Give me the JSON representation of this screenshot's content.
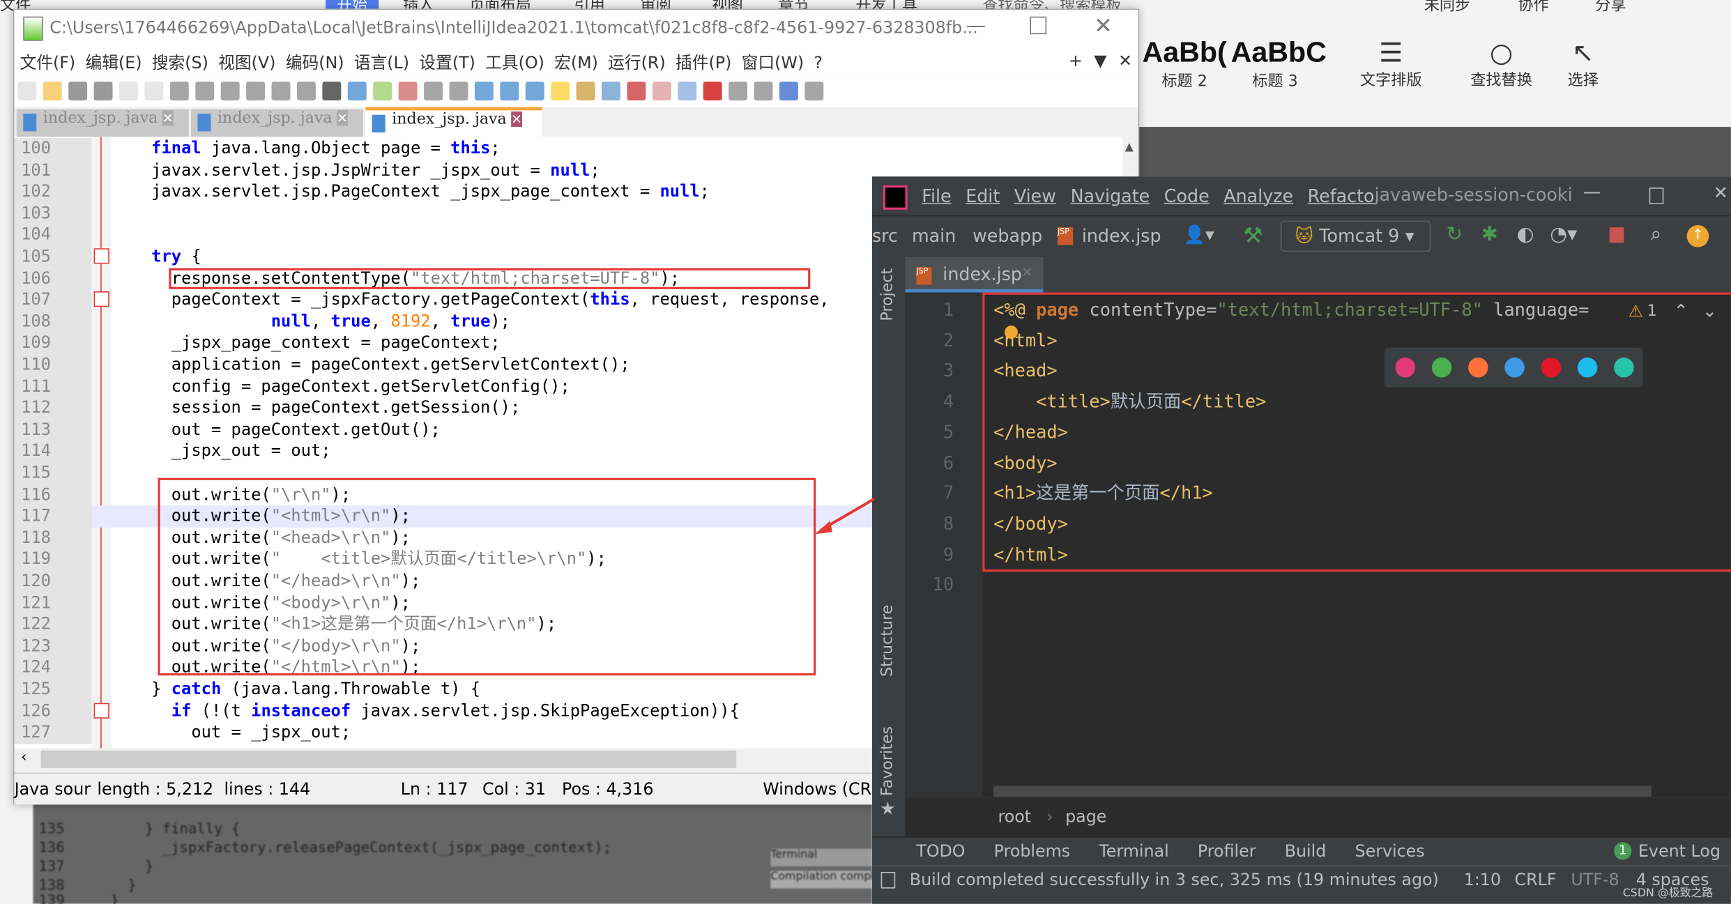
{
  "word_ribbon": {
    "tabs": [
      "文件",
      "开始",
      "插入",
      "页面布局",
      "引用",
      "审阅",
      "视图",
      "章节",
      "开发工具"
    ],
    "search": "查找命令、搜索模板",
    "right_actions": [
      "未同步",
      "协作",
      "分享"
    ],
    "styles": [
      {
        "sample": "AaBb(",
        "label": "标题 2"
      },
      {
        "sample": "AaBbC",
        "label": "标题 3"
      }
    ],
    "buttons": [
      "文字排版",
      "查找替换",
      "选择"
    ]
  },
  "npp": {
    "title": "C:\\Users\\1764466269\\AppData\\Local\\JetBrains\\IntelliJIdea2021.1\\tomcat\\f021c8f8-c8f2-4561-9927-6328308fb...",
    "menu": [
      "文件(F)",
      "编辑(E)",
      "搜索(S)",
      "视图(V)",
      "编码(N)",
      "语言(L)",
      "设置(T)",
      "工具(O)",
      "宏(M)",
      "运行(R)",
      "插件(P)",
      "窗口(W)",
      "?"
    ],
    "tabs": [
      {
        "label": "index_jsp. java"
      },
      {
        "label": "index_jsp. java"
      },
      {
        "label": "index_jsp. java",
        "active": true
      }
    ],
    "highlighted_line": 117,
    "lines": [
      {
        "n": "100",
        "t": [
          [
            "    ",
            ""
          ],
          [
            "final",
            "kw"
          ],
          [
            " java.lang.Object page = ",
            ""
          ],
          [
            "this",
            "kw"
          ],
          [
            ";",
            ""
          ]
        ]
      },
      {
        "n": "101",
        "t": [
          [
            "    javax.servlet.jsp.JspWriter _jspx_out = ",
            ""
          ],
          [
            "null",
            "kw"
          ],
          [
            ";",
            ""
          ]
        ]
      },
      {
        "n": "102",
        "t": [
          [
            "    javax.servlet.jsp.PageContext _jspx_page_context = ",
            ""
          ],
          [
            "null",
            "kw"
          ],
          [
            ";",
            ""
          ]
        ]
      },
      {
        "n": "103",
        "t": []
      },
      {
        "n": "104",
        "t": []
      },
      {
        "n": "105",
        "t": [
          [
            "    ",
            ""
          ],
          [
            "try",
            "kw"
          ],
          [
            " {",
            ""
          ]
        ]
      },
      {
        "n": "106",
        "t": [
          [
            "      response.setContentType(",
            ""
          ],
          [
            "\"text/html;charset=UTF-8\"",
            "str"
          ],
          [
            ");",
            ""
          ]
        ]
      },
      {
        "n": "107",
        "t": [
          [
            "      pageContext = _jspxFactory.getPageContext(",
            ""
          ],
          [
            "this",
            "kw"
          ],
          [
            ", request, response,",
            ""
          ]
        ]
      },
      {
        "n": "108",
        "t": [
          [
            "                ",
            ""
          ],
          [
            "null",
            "kw"
          ],
          [
            ", ",
            ""
          ],
          [
            "true",
            "kw"
          ],
          [
            ", ",
            ""
          ],
          [
            "8192",
            "num"
          ],
          [
            ", ",
            ""
          ],
          [
            "true",
            "kw"
          ],
          [
            ");",
            ""
          ]
        ]
      },
      {
        "n": "109",
        "t": [
          [
            "      _jspx_page_context = pageContext;",
            ""
          ]
        ]
      },
      {
        "n": "110",
        "t": [
          [
            "      application = pageContext.getServletContext();",
            ""
          ]
        ]
      },
      {
        "n": "111",
        "t": [
          [
            "      config = pageContext.getServletConfig();",
            ""
          ]
        ]
      },
      {
        "n": "112",
        "t": [
          [
            "      session = pageContext.getSession();",
            ""
          ]
        ]
      },
      {
        "n": "113",
        "t": [
          [
            "      out = pageContext.getOut();",
            ""
          ]
        ]
      },
      {
        "n": "114",
        "t": [
          [
            "      _jspx_out = out;",
            ""
          ]
        ]
      },
      {
        "n": "115",
        "t": []
      },
      {
        "n": "116",
        "t": [
          [
            "      out.write(",
            ""
          ],
          [
            "\"\\r\\n\"",
            "str"
          ],
          [
            ");",
            ""
          ]
        ]
      },
      {
        "n": "117",
        "t": [
          [
            "      out.write(",
            ""
          ],
          [
            "\"<html>\\r\\n\"",
            "str"
          ],
          [
            ");",
            ""
          ]
        ]
      },
      {
        "n": "118",
        "t": [
          [
            "      out.write(",
            ""
          ],
          [
            "\"<head>\\r\\n\"",
            "str"
          ],
          [
            ");",
            ""
          ]
        ]
      },
      {
        "n": "119",
        "t": [
          [
            "      out.write(",
            ""
          ],
          [
            "\"    <title>默认页面</title>\\r\\n\"",
            "str"
          ],
          [
            ");",
            ""
          ]
        ]
      },
      {
        "n": "120",
        "t": [
          [
            "      out.write(",
            ""
          ],
          [
            "\"</head>\\r\\n\"",
            "str"
          ],
          [
            ");",
            ""
          ]
        ]
      },
      {
        "n": "121",
        "t": [
          [
            "      out.write(",
            ""
          ],
          [
            "\"<body>\\r\\n\"",
            "str"
          ],
          [
            ");",
            ""
          ]
        ]
      },
      {
        "n": "122",
        "t": [
          [
            "      out.write(",
            ""
          ],
          [
            "\"<h1>这是第一个页面</h1>\\r\\n\"",
            "str"
          ],
          [
            ");",
            ""
          ]
        ]
      },
      {
        "n": "123",
        "t": [
          [
            "      out.write(",
            ""
          ],
          [
            "\"</body>\\r\\n\"",
            "str"
          ],
          [
            ");",
            ""
          ]
        ]
      },
      {
        "n": "124",
        "t": [
          [
            "      out.write(",
            ""
          ],
          [
            "\"</html>\\r\\n\"",
            "str"
          ],
          [
            ");",
            ""
          ]
        ]
      },
      {
        "n": "125",
        "t": [
          [
            "    } ",
            ""
          ],
          [
            "catch",
            "kw"
          ],
          [
            " (java.lang.Throwable t) {",
            ""
          ]
        ]
      },
      {
        "n": "126",
        "t": [
          [
            "      ",
            ""
          ],
          [
            "if",
            "kw"
          ],
          [
            " (!(t ",
            ""
          ],
          [
            "instanceof",
            "kw"
          ],
          [
            " javax.servlet.jsp.SkipPageException)){",
            ""
          ]
        ]
      },
      {
        "n": "127",
        "t": [
          [
            "        out = _jspx_out;",
            ""
          ]
        ]
      }
    ],
    "status": {
      "type": "Java sour",
      "length": "length : 5,212",
      "lines": "lines : 144",
      "ln": "Ln : 117",
      "col": "Col : 31",
      "pos": "Pos : 4,316",
      "eol": "Windows (CR"
    }
  },
  "background_code": [
    {
      "n": "135",
      "text": "    } finally {"
    },
    {
      "n": "136",
      "text": "      _jspxFactory.releasePageContext(_jspx_page_context);"
    },
    {
      "n": "137",
      "text": "    }"
    },
    {
      "n": "138",
      "text": "  }"
    },
    {
      "n": "139",
      "text": "}"
    }
  ],
  "background_panel": [
    "Terminal",
    "Compilation compl"
  ],
  "intellij": {
    "menu": [
      "File",
      "Edit",
      "View",
      "Navigate",
      "Code",
      "Analyze",
      "Refacto"
    ],
    "project_title": "javaweb-session-cooki",
    "breadcrumb": [
      "src",
      "main",
      "webapp",
      "index.jsp"
    ],
    "run_config": "Tomcat 9",
    "tab": "index.jsp",
    "side_tools": [
      "Project",
      "Structure",
      "Favorites"
    ],
    "warning_count": "1",
    "lines": [
      {
        "n": "1",
        "t": [
          [
            "<%@ ",
            "tag"
          ],
          [
            "page ",
            "dir"
          ],
          [
            "contentType=",
            "attr"
          ],
          [
            "\"text/html;charset=UTF-8\"",
            "jstr"
          ],
          [
            " language=",
            "attr"
          ]
        ]
      },
      {
        "n": "2",
        "t": [
          [
            "<html>",
            "tag"
          ]
        ]
      },
      {
        "n": "3",
        "t": [
          [
            "<head>",
            "tag"
          ]
        ]
      },
      {
        "n": "4",
        "t": [
          [
            "    <title>",
            "tag"
          ],
          [
            "默认页面",
            ""
          ],
          [
            "</title>",
            "tag"
          ]
        ]
      },
      {
        "n": "5",
        "t": [
          [
            "</head>",
            "tag"
          ]
        ]
      },
      {
        "n": "6",
        "t": [
          [
            "<body>",
            "tag"
          ]
        ]
      },
      {
        "n": "7",
        "t": [
          [
            "<h1>",
            "tag"
          ],
          [
            "这是第一个页面",
            ""
          ],
          [
            "</h1>",
            "tag"
          ]
        ]
      },
      {
        "n": "8",
        "t": [
          [
            "</body>",
            "tag"
          ]
        ]
      },
      {
        "n": "9",
        "t": [
          [
            "</html>",
            "tag"
          ]
        ]
      },
      {
        "n": "10",
        "t": []
      }
    ],
    "code_crumb": [
      "root",
      "page"
    ],
    "tool_windows": [
      "TODO",
      "Problems",
      "Terminal",
      "Profiler",
      "Build",
      "Services"
    ],
    "event_log": "Event Log",
    "event_count": "1",
    "status_message": "Build completed successfully in 3 sec, 325 ms (19 minutes ago)",
    "caret": "1:10",
    "line_sep": "CRLF",
    "encoding": "UTF-8",
    "indent": "4 spaces",
    "browsers": [
      "intellij",
      "chrome",
      "firefox",
      "safari",
      "opera",
      "ie",
      "edge"
    ]
  },
  "watermark": "CSDN @极致之路",
  "colors": {
    "annotation": "#e53935",
    "ij_bg": "#2b2b2b",
    "npp_keyword": "#0000ff"
  }
}
